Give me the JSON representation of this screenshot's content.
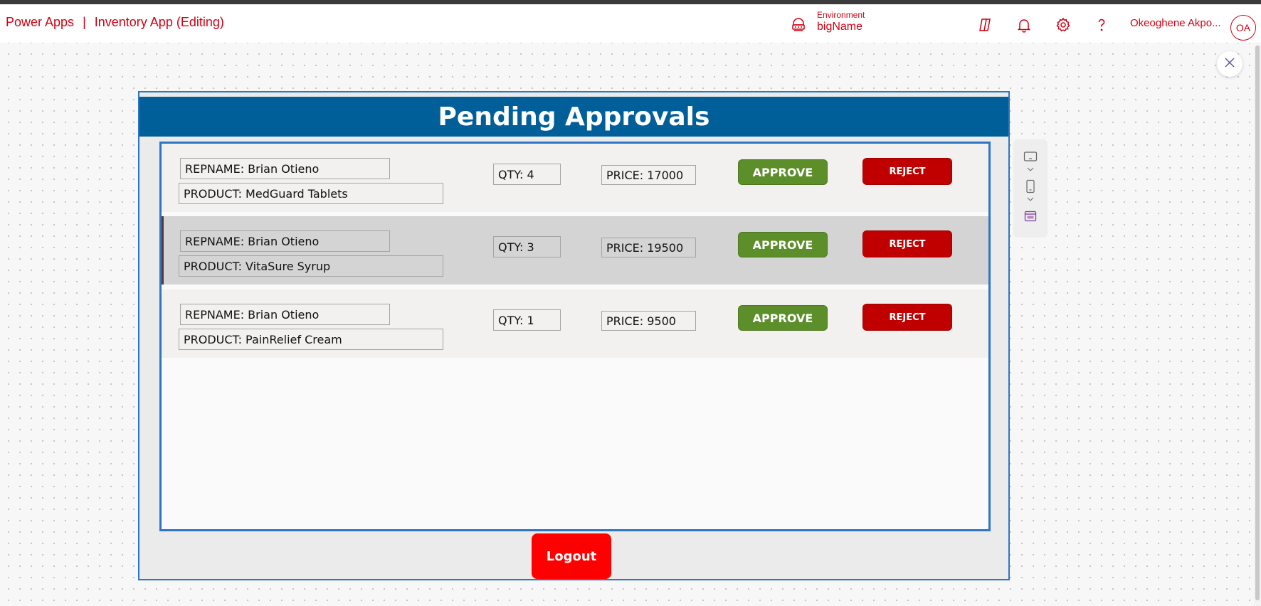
{
  "app": {
    "product": "Power Apps",
    "separator": "|",
    "app_title": "Inventory App (Editing)"
  },
  "environment": {
    "label": "Environment",
    "name": "bigName"
  },
  "user": {
    "name": "Okeoghene Akpo...",
    "initials": "OA"
  },
  "icons": {
    "environment": "environment-icon",
    "copilot": "copilot-icon",
    "notifications": "bell-icon",
    "settings": "gear-icon",
    "help": "question-icon",
    "close": "close-icon",
    "tablet": "tablet-icon",
    "phone": "phone-icon",
    "screen": "screen-icon"
  },
  "colors": {
    "brand": "#d10012",
    "header_blue": "#005f99",
    "approve_green": "#5c8e2a",
    "reject_red": "#c00000",
    "logout_red": "#ff0000",
    "selection_blue": "#2e75c8"
  },
  "screen": {
    "title": "Pending Approvals",
    "rows": [
      {
        "rep": "REPNAME: Brian Otieno",
        "product": "PRODUCT: MedGuard Tablets",
        "qty": "QTY:  4",
        "price": "PRICE: 17000",
        "approve": "APPROVE",
        "reject": "REJECT"
      },
      {
        "rep": "REPNAME: Brian Otieno",
        "product": "PRODUCT: VitaSure Syrup",
        "qty": "QTY:  3",
        "price": "PRICE: 19500",
        "approve": "APPROVE",
        "reject": "REJECT"
      },
      {
        "rep": "REPNAME: Brian Otieno",
        "product": "PRODUCT: PainRelief Cream",
        "qty": "QTY:  1",
        "price": "PRICE: 9500",
        "approve": "APPROVE",
        "reject": "REJECT"
      }
    ],
    "logout": "Logout"
  }
}
